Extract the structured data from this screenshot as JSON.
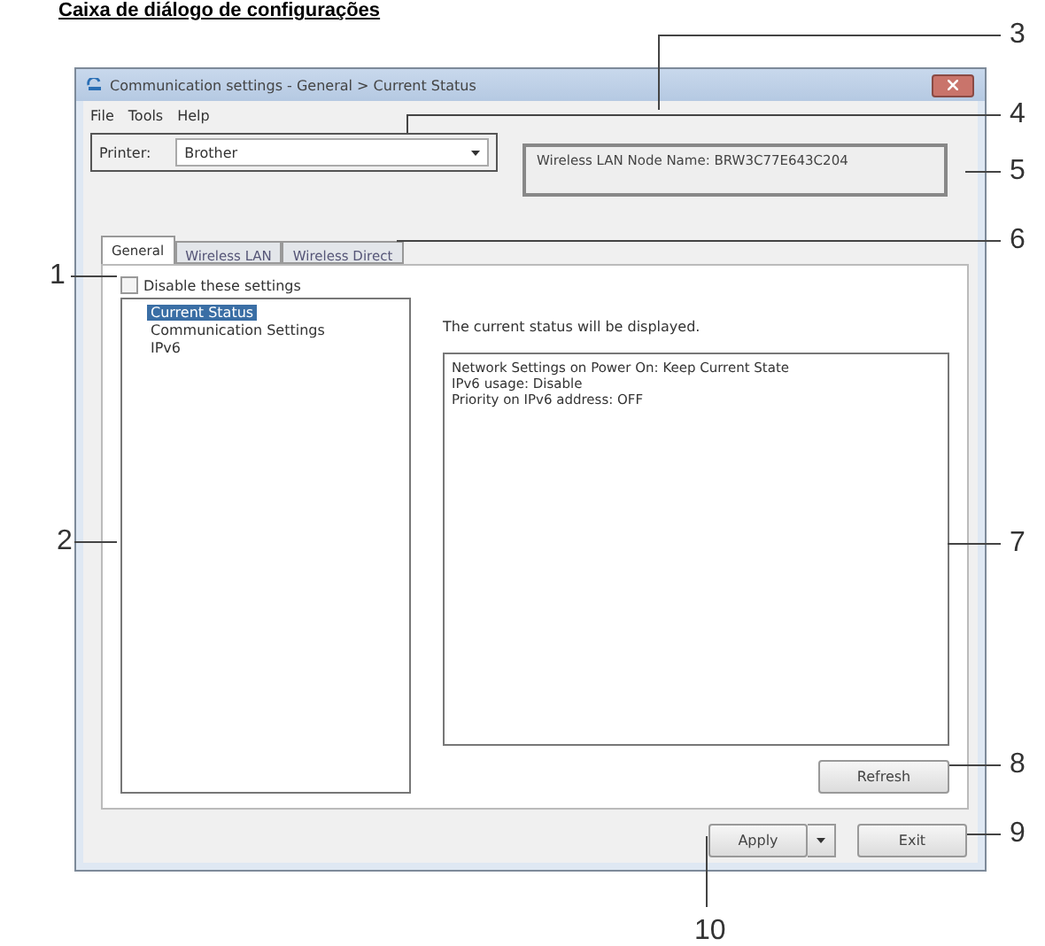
{
  "heading": "Caixa de diálogo de configurações",
  "window": {
    "title": "Communication settings - General > Current Status"
  },
  "menu": [
    {
      "label": "File"
    },
    {
      "label": "Tools"
    },
    {
      "label": "Help"
    }
  ],
  "printer": {
    "label": "Printer:",
    "value": "Brother"
  },
  "node_name": "Wireless LAN Node Name: BRW3C77E643C204",
  "tabs": [
    {
      "label": "General",
      "selected": true
    },
    {
      "label": "Wireless LAN",
      "selected": false
    },
    {
      "label": "Wireless Direct",
      "selected": false
    }
  ],
  "disable_settings": {
    "label": "Disable these settings",
    "checked": false
  },
  "tree": [
    {
      "label": "Current Status",
      "selected": true
    },
    {
      "label": "Communication Settings",
      "selected": false
    },
    {
      "label": "IPv6",
      "selected": false
    }
  ],
  "description": "The current status will be displayed.",
  "status_lines": [
    "Network Settings on Power On: Keep Current State",
    "IPv6 usage: Disable",
    "Priority on IPv6 address: OFF"
  ],
  "refresh_button": "Refresh",
  "apply_button": "Apply",
  "exit_button": "Exit",
  "callouts": [
    "1",
    "2",
    "3",
    "4",
    "5",
    "6",
    "7",
    "8",
    "9",
    "10"
  ]
}
